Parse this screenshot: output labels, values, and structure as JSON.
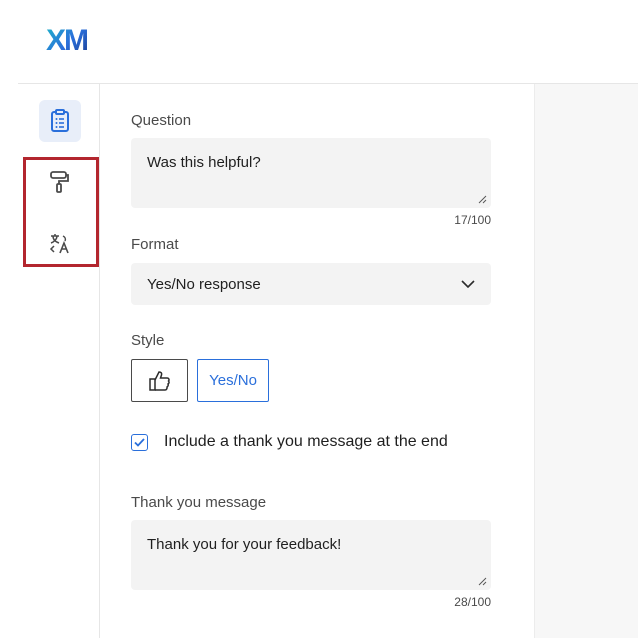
{
  "app": {
    "logo_text": "XM"
  },
  "rail": {
    "items": [
      {
        "name": "survey",
        "icon": "clipboard-list-icon",
        "active": true
      },
      {
        "name": "look-and-feel",
        "icon": "paint-roller-icon",
        "active": false
      },
      {
        "name": "translate",
        "icon": "translate-icon",
        "active": false
      }
    ]
  },
  "editor": {
    "question": {
      "label": "Question",
      "value": "Was this helpful?",
      "counter": "17/100"
    },
    "format": {
      "label": "Format",
      "selected": "Yes/No response"
    },
    "style": {
      "label": "Style",
      "options": [
        {
          "icon": "thumbs-up-icon"
        },
        {
          "label": "Yes/No",
          "selected": true
        }
      ]
    },
    "thank_you_toggle": {
      "label": "Include a thank you message at the end",
      "checked": true
    },
    "thank_you_message": {
      "label": "Thank you message",
      "value": "Thank you for your feedback!",
      "counter": "28/100"
    }
  },
  "colors": {
    "brand_blue": "#2a6fdb",
    "logo_teal": "#1fb6c9",
    "logo_navy": "#1c3f94",
    "highlight_red": "#b3262e"
  }
}
